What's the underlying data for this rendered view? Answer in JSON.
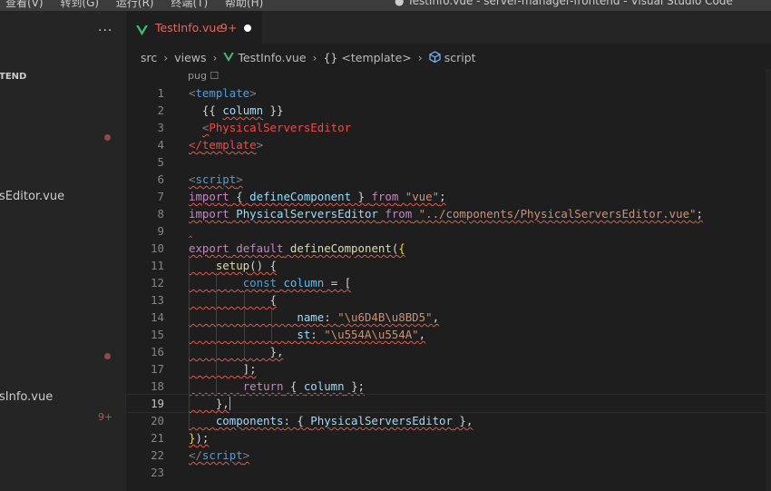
{
  "menubar": {
    "items": [
      "查看(V)",
      "转到(G)",
      "运行(R)",
      "终端(T)",
      "帮助(H)"
    ],
    "window_title": "● TestInfo.vue - server-manager-frontend - Visual Studio Code"
  },
  "sidebar": {
    "more_label": "···",
    "section_title": "TEND",
    "files": [
      "sEditor.vue",
      "sInfo.vue"
    ],
    "badge": "9+"
  },
  "tab": {
    "filename": "TestInfo.vue",
    "badge": "9+"
  },
  "breadcrumb": {
    "src": "src",
    "views": "views",
    "file": "TestInfo.vue",
    "template": "<template>",
    "script": "script"
  },
  "editor": {
    "lang_label": "pug ☐",
    "lines": [
      {
        "n": "1",
        "tokens": [
          {
            "t": "<",
            "c": "#808080"
          },
          {
            "t": "template",
            "c": "#569cd6"
          },
          {
            "t": ">",
            "c": "#808080"
          }
        ]
      },
      {
        "n": "2",
        "tokens": [
          {
            "t": "  {{ ",
            "c": "#d4d4d4"
          },
          {
            "t": "column",
            "c": "#9cdcfe",
            "s": true
          },
          {
            "t": " }}",
            "c": "#d4d4d4"
          }
        ]
      },
      {
        "n": "3",
        "tokens": [
          {
            "t": "  ",
            "c": "#d4d4d4"
          },
          {
            "t": "<",
            "c": "#808080",
            "s": true
          },
          {
            "t": "PhysicalServersEditor",
            "c": "#f44747"
          }
        ]
      },
      {
        "n": "4",
        "tokens": [
          {
            "t": "</",
            "c": "#f44747",
            "s": true
          },
          {
            "t": "template",
            "c": "#f44747",
            "s": true
          },
          {
            "t": ">",
            "c": "#808080"
          }
        ]
      },
      {
        "n": "5",
        "tokens": []
      },
      {
        "n": "6",
        "tokens": [
          {
            "t": "<",
            "c": "#808080",
            "s": true
          },
          {
            "t": "script",
            "c": "#569cd6",
            "s": true
          },
          {
            "t": ">",
            "c": "#808080",
            "s": true
          }
        ]
      },
      {
        "n": "7",
        "tokens": [
          {
            "t": "import",
            "c": "#c586c0",
            "s": true
          },
          {
            "t": " { ",
            "c": "#d4d4d4",
            "s": true
          },
          {
            "t": "defineComponent",
            "c": "#9cdcfe",
            "s": true
          },
          {
            "t": " } ",
            "c": "#d4d4d4",
            "s": true
          },
          {
            "t": "from",
            "c": "#c586c0",
            "s": true
          },
          {
            "t": " ",
            "c": "#d4d4d4",
            "s": true
          },
          {
            "t": "\"vue\"",
            "c": "#ce9178",
            "s": true
          },
          {
            "t": ";",
            "c": "#d4d4d4",
            "s": true
          }
        ]
      },
      {
        "n": "8",
        "tokens": [
          {
            "t": "import",
            "c": "#c586c0",
            "s": true
          },
          {
            "t": " ",
            "c": "#d4d4d4",
            "s": true
          },
          {
            "t": "PhysicalServersEditor",
            "c": "#9cdcfe",
            "s": true
          },
          {
            "t": " ",
            "c": "#d4d4d4",
            "s": true
          },
          {
            "t": "from",
            "c": "#c586c0",
            "s": true
          },
          {
            "t": " ",
            "c": "#d4d4d4",
            "s": true
          },
          {
            "t": "\"../components/PhysicalServersEditor.vue\"",
            "c": "#ce9178",
            "s": true
          },
          {
            "t": ";",
            "c": "#d4d4d4",
            "s": true
          }
        ]
      },
      {
        "n": "9",
        "tokens": [
          {
            "t": "‸",
            "c": "#e05a4e"
          }
        ]
      },
      {
        "n": "10",
        "tokens": [
          {
            "t": "export",
            "c": "#c586c0",
            "s": true
          },
          {
            "t": " ",
            "c": "#d4d4d4",
            "s": true
          },
          {
            "t": "default",
            "c": "#c586c0",
            "s": true
          },
          {
            "t": " ",
            "c": "#d4d4d4",
            "s": true
          },
          {
            "t": "defineComponent",
            "c": "#dcdcaa",
            "s": true
          },
          {
            "t": "(",
            "c": "#d4d4d4",
            "s": true
          },
          {
            "t": "{",
            "c": "#ffd700",
            "s": true
          }
        ]
      },
      {
        "n": "11",
        "tokens": [
          {
            "t": "    ",
            "c": "#d4d4d4",
            "s": true
          },
          {
            "t": "setup",
            "c": "#dcdcaa",
            "s": true
          },
          {
            "t": "() {",
            "c": "#d4d4d4",
            "s": true
          }
        ]
      },
      {
        "n": "12",
        "tokens": [
          {
            "t": "        ",
            "c": "#d4d4d4",
            "s": true
          },
          {
            "t": "const",
            "c": "#569cd6",
            "s": true
          },
          {
            "t": " ",
            "c": "#d4d4d4",
            "s": true
          },
          {
            "t": "column",
            "c": "#4fc1ff",
            "s": true
          },
          {
            "t": " = [",
            "c": "#d4d4d4",
            "s": true
          }
        ]
      },
      {
        "n": "13",
        "tokens": [
          {
            "t": "            {",
            "c": "#d4d4d4",
            "s": true
          }
        ]
      },
      {
        "n": "14",
        "tokens": [
          {
            "t": "                ",
            "c": "#d4d4d4",
            "s": true
          },
          {
            "t": "name",
            "c": "#9cdcfe",
            "s": true
          },
          {
            "t": ": ",
            "c": "#d4d4d4",
            "s": true
          },
          {
            "t": "\"\\u6D4B\\u8BD5\"",
            "c": "#ce9178",
            "s": true
          },
          {
            "t": ",",
            "c": "#d4d4d4",
            "s": true
          }
        ]
      },
      {
        "n": "15",
        "tokens": [
          {
            "t": "                ",
            "c": "#d4d4d4",
            "s": true
          },
          {
            "t": "st",
            "c": "#9cdcfe",
            "s": true
          },
          {
            "t": ": ",
            "c": "#d4d4d4",
            "s": true
          },
          {
            "t": "\"\\u554A\\u554A\"",
            "c": "#ce9178",
            "s": true
          },
          {
            "t": ",",
            "c": "#d4d4d4",
            "s": true
          }
        ]
      },
      {
        "n": "16",
        "tokens": [
          {
            "t": "            },",
            "c": "#d4d4d4",
            "s": true
          }
        ]
      },
      {
        "n": "17",
        "tokens": [
          {
            "t": "        ];",
            "c": "#d4d4d4",
            "s": true
          }
        ]
      },
      {
        "n": "18",
        "tokens": [
          {
            "t": "        ",
            "c": "#d4d4d4",
            "s": true
          },
          {
            "t": "return",
            "c": "#c586c0",
            "s": true
          },
          {
            "t": " { ",
            "c": "#d4d4d4",
            "s": true
          },
          {
            "t": "column",
            "c": "#9cdcfe",
            "s": true
          },
          {
            "t": " };",
            "c": "#d4d4d4",
            "s": true
          }
        ]
      },
      {
        "n": "19",
        "tokens": [
          {
            "t": "    },",
            "c": "#d4d4d4",
            "s": true
          }
        ],
        "current": true
      },
      {
        "n": "20",
        "tokens": [
          {
            "t": "    ",
            "c": "#d4d4d4",
            "s": true
          },
          {
            "t": "components",
            "c": "#9cdcfe",
            "s": true
          },
          {
            "t": ": { ",
            "c": "#d4d4d4",
            "s": true
          },
          {
            "t": "PhysicalServersEditor",
            "c": "#9cdcfe",
            "s": true
          },
          {
            "t": " },",
            "c": "#d4d4d4",
            "s": true
          }
        ]
      },
      {
        "n": "21",
        "tokens": [
          {
            "t": "}",
            "c": "#ffd700",
            "s": true
          },
          {
            "t": ");",
            "c": "#d4d4d4",
            "s": true
          }
        ]
      },
      {
        "n": "22",
        "tokens": [
          {
            "t": "</",
            "c": "#808080",
            "s": true
          },
          {
            "t": "script",
            "c": "#569cd6",
            "s": true
          },
          {
            "t": ">",
            "c": "#808080",
            "s": true
          }
        ]
      },
      {
        "n": "23",
        "tokens": []
      }
    ]
  },
  "colors": {
    "editor_bg": "#1e1e1e",
    "sidebar_bg": "#252526",
    "error_red": "#e0685f",
    "vue_green": "#41b883"
  }
}
